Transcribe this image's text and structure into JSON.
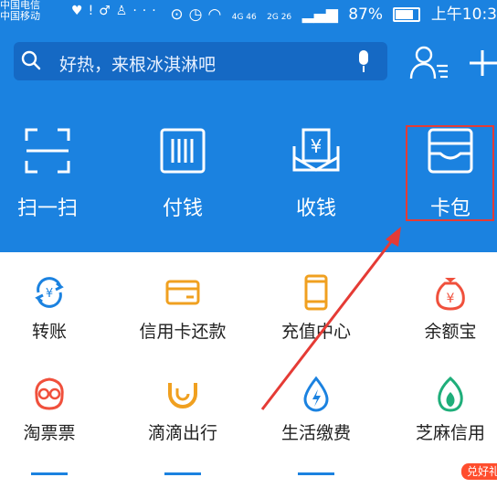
{
  "status_bar": {
    "carrier_1": "中国电信",
    "carrier_2": "中国移动",
    "network_1": "4G 46",
    "network_2": "2G 26",
    "battery": "87%",
    "time": "上午10:3"
  },
  "search": {
    "placeholder": "好热，来根冰淇淋吧"
  },
  "quick_actions": [
    {
      "label": "扫一扫",
      "icon": "scan-icon"
    },
    {
      "label": "付钱",
      "icon": "barcode-icon"
    },
    {
      "label": "收钱",
      "icon": "yen-receive-icon"
    },
    {
      "label": "卡包",
      "icon": "wallet-icon"
    }
  ],
  "grid": [
    {
      "label": "转账",
      "icon": "transfer-icon",
      "color": "#1b82e0"
    },
    {
      "label": "信用卡还款",
      "icon": "credit-card-icon",
      "color": "#f0a020"
    },
    {
      "label": "充值中心",
      "icon": "phone-icon",
      "color": "#f0a020"
    },
    {
      "label": "余额宝",
      "icon": "money-bag-icon",
      "color": "#f0503c"
    },
    {
      "label": "淘票票",
      "icon": "movie-mascot-icon",
      "color": "#f0503c"
    },
    {
      "label": "滴滴出行",
      "icon": "didi-icon",
      "color": "#f0a020"
    },
    {
      "label": "生活缴费",
      "icon": "utility-drop-icon",
      "color": "#1b82e0"
    },
    {
      "label": "芝麻信用",
      "icon": "sesame-icon",
      "color": "#1fae7a"
    }
  ],
  "badge": {
    "text": "兑好礼"
  },
  "colors": {
    "brand_blue": "#1b82e0",
    "highlight_red": "#e53b35"
  }
}
